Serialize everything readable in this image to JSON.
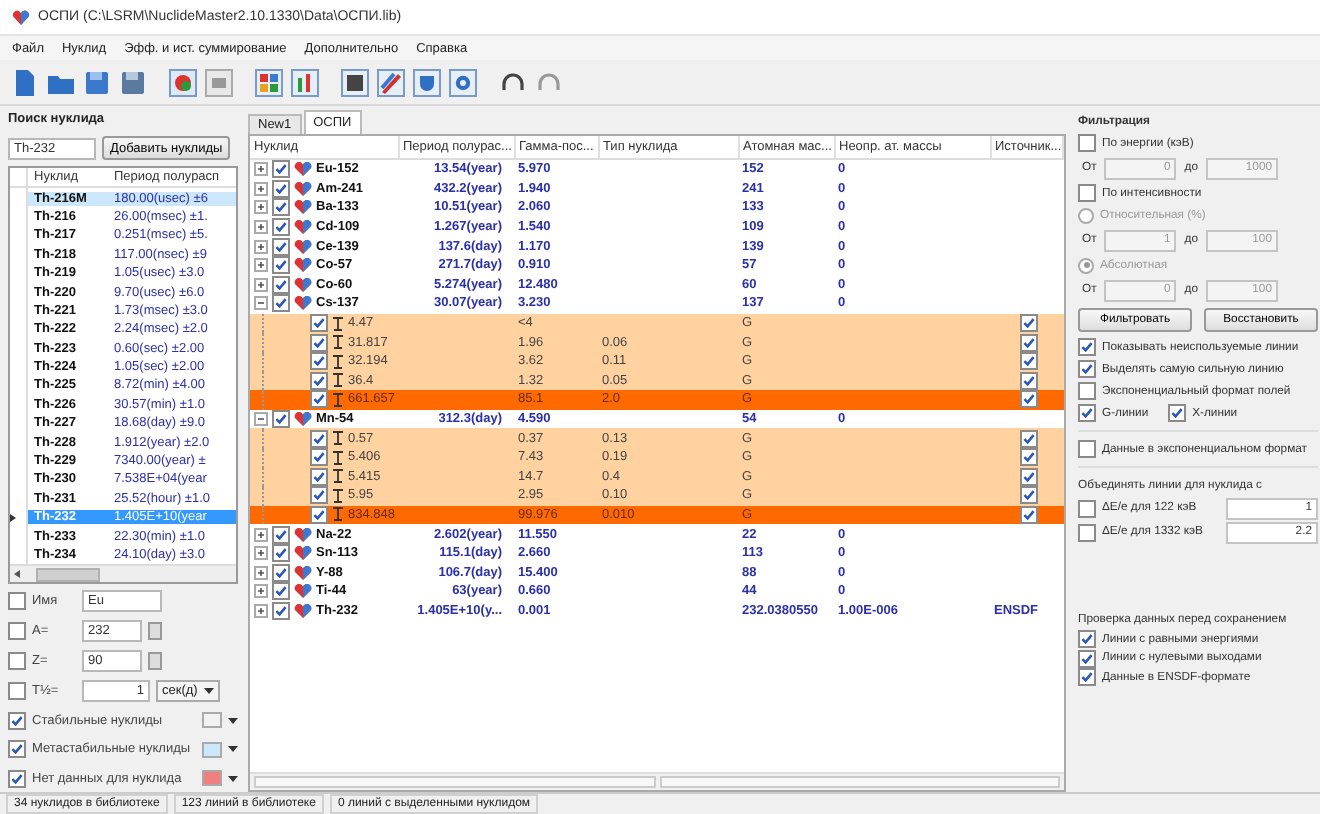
{
  "window": {
    "title": "ОСПИ (C:\\LSRM\\NuclideMaster2.10.1330\\Data\\ОСПИ.lib)"
  },
  "menu": [
    "Файл",
    "Нуклид",
    "Эфф. и ист. суммирование",
    "Дополнительно",
    "Справка"
  ],
  "search": {
    "title": "Поиск нуклида",
    "value": "Th-232",
    "button": "Добавить нуклиды"
  },
  "nuclide_list": {
    "columns": [
      "Нуклид",
      "Период полурасп"
    ],
    "rows": [
      {
        "name": "Th-216M",
        "period": "180.00(usec) ±6",
        "metastable": true,
        "selected": false
      },
      {
        "name": "Th-216",
        "period": "26.00(msec) ±1.",
        "metastable": false,
        "selected": false
      },
      {
        "name": "Th-217",
        "period": "0.251(msec) ±5.",
        "metastable": false,
        "selected": false
      },
      {
        "name": "Th-218",
        "period": "117.00(nsec) ±9",
        "metastable": false,
        "selected": false
      },
      {
        "name": "Th-219",
        "period": "1.05(usec) ±3.0",
        "metastable": false,
        "selected": false
      },
      {
        "name": "Th-220",
        "period": "9.70(usec) ±6.0",
        "metastable": false,
        "selected": false
      },
      {
        "name": "Th-221",
        "period": "1.73(msec) ±3.0",
        "metastable": false,
        "selected": false
      },
      {
        "name": "Th-222",
        "period": "2.24(msec) ±2.0",
        "metastable": false,
        "selected": false
      },
      {
        "name": "Th-223",
        "period": "0.60(sec) ±2.00",
        "metastable": false,
        "selected": false
      },
      {
        "name": "Th-224",
        "period": "1.05(sec) ±2.00",
        "metastable": false,
        "selected": false
      },
      {
        "name": "Th-225",
        "period": "8.72(min) ±4.00",
        "metastable": false,
        "selected": false
      },
      {
        "name": "Th-226",
        "period": "30.57(min) ±1.0",
        "metastable": false,
        "selected": false
      },
      {
        "name": "Th-227",
        "period": "18.68(day) ±9.0",
        "metastable": false,
        "selected": false
      },
      {
        "name": "Th-228",
        "period": "1.912(year) ±2.0",
        "metastable": false,
        "selected": false
      },
      {
        "name": "Th-229",
        "period": "7340.00(year) ±",
        "metastable": false,
        "selected": false
      },
      {
        "name": "Th-230",
        "period": "7.538E+04(year",
        "metastable": false,
        "selected": false
      },
      {
        "name": "Th-231",
        "period": "25.52(hour) ±1.0",
        "metastable": false,
        "selected": false
      },
      {
        "name": "Th-232",
        "period": "1.405E+10(year",
        "metastable": false,
        "selected": true
      },
      {
        "name": "Th-233",
        "period": "22.30(min) ±1.0",
        "metastable": false,
        "selected": false
      },
      {
        "name": "Th-234",
        "period": "24.10(day) ±3.0",
        "metastable": false,
        "selected": false
      }
    ]
  },
  "list_filters": [
    {
      "kind": "text",
      "label": "Имя",
      "checked": false,
      "value": "Eu"
    },
    {
      "kind": "spin",
      "label": "A=",
      "checked": false,
      "value": "232"
    },
    {
      "kind": "spin",
      "label": "Z=",
      "checked": false,
      "value": "90"
    },
    {
      "kind": "time",
      "label": "T½=",
      "checked": false,
      "value": "1",
      "unit": "сек(д)"
    }
  ],
  "legend": [
    {
      "label": "Стабильные нуклиды",
      "checked": true,
      "color": "#f2f2f2"
    },
    {
      "label": "Метастабильные нуклиды",
      "checked": true,
      "color": "#cce6fa"
    },
    {
      "label": "Нет данных для нуклида",
      "checked": true,
      "color": "#f08080"
    }
  ],
  "tabs": [
    {
      "label": "New1",
      "selected": false
    },
    {
      "label": "ОСПИ",
      "selected": true
    }
  ],
  "table": {
    "columns": [
      "Нуклид",
      "Период полурас...",
      "Гамма-пос...",
      "Тип нуклида",
      "Атомная мас...",
      "Неопр. ат. массы",
      "Источник..."
    ],
    "rows": [
      {
        "name": "Eu-152",
        "checked": true,
        "expanded": false,
        "period": "13.54(year)",
        "gamma": "5.970",
        "mass": "152",
        "mass_unc": "0"
      },
      {
        "name": "Am-241",
        "checked": true,
        "expanded": false,
        "period": "432.2(year)",
        "gamma": "1.940",
        "mass": "241",
        "mass_unc": "0"
      },
      {
        "name": "Ba-133",
        "checked": true,
        "expanded": false,
        "period": "10.51(year)",
        "gamma": "2.060",
        "mass": "133",
        "mass_unc": "0"
      },
      {
        "name": "Cd-109",
        "checked": true,
        "expanded": false,
        "period": "1.267(year)",
        "gamma": "1.540",
        "mass": "109",
        "mass_unc": "0"
      },
      {
        "name": "Ce-139",
        "checked": true,
        "expanded": false,
        "period": "137.6(day)",
        "gamma": "1.170",
        "mass": "139",
        "mass_unc": "0"
      },
      {
        "name": "Co-57",
        "checked": true,
        "expanded": false,
        "period": "271.7(day)",
        "gamma": "0.910",
        "mass": "57",
        "mass_unc": "0"
      },
      {
        "name": "Co-60",
        "checked": true,
        "expanded": false,
        "period": "5.274(year)",
        "gamma": "12.480",
        "mass": "60",
        "mass_unc": "0"
      },
      {
        "name": "Cs-137",
        "checked": true,
        "expanded": true,
        "period": "30.07(year)",
        "gamma": "3.230",
        "mass": "137",
        "mass_unc": "0",
        "children": [
          {
            "energy": "4.47",
            "intensity": "<4",
            "type": "G",
            "checked": true,
            "source_checked": true,
            "strongest": false
          },
          {
            "energy": "31.817",
            "intensity": "1.96",
            "uncertainty": "0.06",
            "type": "G",
            "checked": true,
            "source_checked": true,
            "strongest": false
          },
          {
            "energy": "32.194",
            "intensity": "3.62",
            "uncertainty": "0.11",
            "type": "G",
            "checked": true,
            "source_checked": true,
            "strongest": false
          },
          {
            "energy": "36.4",
            "intensity": "1.32",
            "uncertainty": "0.05",
            "type": "G",
            "checked": true,
            "source_checked": true,
            "strongest": false
          },
          {
            "energy": "661.657",
            "intensity": "85.1",
            "uncertainty": "2.0",
            "type": "G",
            "checked": true,
            "source_checked": true,
            "strongest": true
          }
        ]
      },
      {
        "name": "Mn-54",
        "checked": true,
        "expanded": true,
        "period": "312.3(day)",
        "gamma": "4.590",
        "mass": "54",
        "mass_unc": "0",
        "children": [
          {
            "energy": "0.57",
            "intensity": "0.37",
            "uncertainty": "0.13",
            "type": "G",
            "checked": true,
            "source_checked": true,
            "strongest": false
          },
          {
            "energy": "5.406",
            "intensity": "7.43",
            "uncertainty": "0.19",
            "type": "G",
            "checked": true,
            "source_checked": true,
            "strongest": false
          },
          {
            "energy": "5.415",
            "intensity": "14.7",
            "uncertainty": "0.4",
            "type": "G",
            "checked": true,
            "source_checked": true,
            "strongest": false
          },
          {
            "energy": "5.95",
            "intensity": "2.95",
            "uncertainty": "0.10",
            "type": "G",
            "checked": true,
            "source_checked": true,
            "strongest": false
          },
          {
            "energy": "834.848",
            "intensity": "99.976",
            "uncertainty": "0.010",
            "type": "G",
            "checked": true,
            "source_checked": true,
            "strongest": true
          }
        ]
      },
      {
        "name": "Na-22",
        "checked": true,
        "expanded": false,
        "period": "2.602(year)",
        "gamma": "11.550",
        "mass": "22",
        "mass_unc": "0"
      },
      {
        "name": "Sn-113",
        "checked": true,
        "expanded": false,
        "period": "115.1(day)",
        "gamma": "2.660",
        "mass": "113",
        "mass_unc": "0"
      },
      {
        "name": "Y-88",
        "checked": true,
        "expanded": false,
        "period": "106.7(day)",
        "gamma": "15.400",
        "mass": "88",
        "mass_unc": "0"
      },
      {
        "name": "Ti-44",
        "checked": true,
        "expanded": false,
        "period": "63(year)",
        "gamma": "0.660",
        "mass": "44",
        "mass_unc": "0"
      },
      {
        "name": "Th-232",
        "checked": true,
        "expanded": false,
        "period": "1.405E+10(y...",
        "gamma": "0.001",
        "mass": "232.0380550",
        "mass_unc": "1.00E-006",
        "source": "ENSDF"
      }
    ]
  },
  "filter_panel": {
    "title": "Фильтрация",
    "energy": {
      "label": "По энергии (кэВ)",
      "checked": false,
      "from_label": "От",
      "from": "0",
      "to_label": "до",
      "to": "1000"
    },
    "intensity": {
      "label": "По интенсивности",
      "checked": false,
      "modes": [
        {
          "label": "Относительная (%)",
          "selected": false,
          "from_label": "От",
          "from": "1",
          "to_label": "до",
          "to": "100"
        },
        {
          "label": "Абсолютная",
          "selected": true,
          "from_label": "От",
          "from": "0",
          "to_label": "до",
          "to": "100"
        }
      ]
    },
    "buttons": [
      "Фильтровать",
      "Восстановить"
    ],
    "options": [
      {
        "label": "Показывать неиспользуемые линии",
        "checked": true
      },
      {
        "label": "Выделять самую сильную линию",
        "checked": true
      },
      {
        "label": "Экспоненциальный формат полей",
        "checked": false
      }
    ],
    "line_types": [
      {
        "label": "G-линии",
        "checked": true
      },
      {
        "label": "X-линии",
        "checked": true
      }
    ]
  },
  "exp_format": {
    "label": "Данные в экспоненциальном формат",
    "checked": false
  },
  "merge": {
    "title": "Объединять линии для нуклида с",
    "rows": [
      {
        "label": "ΔE/e для 122 кэВ",
        "checked": false,
        "value": "1"
      },
      {
        "label": "ΔE/e для 1332 кэВ",
        "checked": false,
        "value": "2.2"
      }
    ]
  },
  "save_check": {
    "title": "Проверка данных перед сохранением",
    "items": [
      {
        "label": "Линии с равными энергиями",
        "checked": true
      },
      {
        "label": "Линии с нулевыми выходами",
        "checked": true
      },
      {
        "label": "Данные в ENSDF-формате",
        "checked": true
      }
    ]
  },
  "status_bar": [
    "34 нуклидов в библиотеке",
    "123 линий в библиотеке",
    "0 линий с выделенными нуклидом"
  ]
}
